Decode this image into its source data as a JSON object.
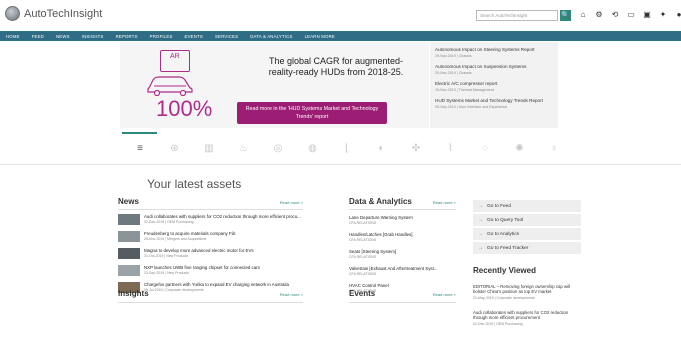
{
  "app": {
    "title": "AutoTechInsight"
  },
  "search": {
    "placeholder": "Search AutoTechInsight",
    "button": "🔍"
  },
  "top_icons": [
    "home-icon",
    "settings-gear-icon",
    "notification-icon",
    "message-icon",
    "calendar-icon",
    "gear-icon",
    "user-icon"
  ],
  "top_icon_glyphs": [
    "⌂",
    "⚙",
    "⟲",
    "▭",
    "▣",
    "✦",
    "●"
  ],
  "nav": [
    "HOME",
    "FEED",
    "NEWS",
    "INSIGHTS",
    "REPORTS",
    "PROFILES",
    "EVENTS",
    "SERVICES",
    "DATA & ANALYTICS",
    "LEARN MORE"
  ],
  "banner": {
    "badge": "AR",
    "percent": "100%",
    "headline": "The global CAGR for augmented-reality-ready HUDs from 2018-25.",
    "cta": "Read more in the 'HUD Systems Market and Technology Trends' report"
  },
  "reports": [
    {
      "title": "Autonomous Impact on Steering Systems Report",
      "meta": "29-Nov-2019 | Chassis"
    },
    {
      "title": "Autonomous Impact on Suspension Systems",
      "meta": "29-Nov-2019 | Chassis"
    },
    {
      "title": "Electric A/C compressor report",
      "meta": "19-Nov-2019 | Thermal Management"
    },
    {
      "title": "HUD Systems Market and Technology Trends Report",
      "meta": "05-Sep-2019 | User Interface and Experience"
    }
  ],
  "category_icons": [
    "list-icon",
    "wheel-icon",
    "battery-icon",
    "engine-icon",
    "steering-wheel-icon",
    "gauge-icon",
    "seat-icon",
    "thermal-icon",
    "molecule-icon",
    "wiper-icon",
    "sensor-icon",
    "fan-icon",
    "person-icon"
  ],
  "category_glyphs": [
    "≡",
    "⊛",
    "▥",
    "♨",
    "◎",
    "◍",
    "⌊",
    "◐",
    "✣",
    "⌇",
    "◌",
    "✺",
    "♀"
  ],
  "assets": {
    "title": "Your latest assets"
  },
  "news": {
    "heading": "News",
    "more": "Read more >",
    "items": [
      {
        "title": "Audi collaborates with suppliers for CO2 reduction through more efficient procu...",
        "meta": "02-Dec-2019 | OEM Purchasing"
      },
      {
        "title": "Freudenberg to acquire materials company Filc",
        "meta": "26-Nov-2019 | Mergers and Acquisitions"
      },
      {
        "title": "Magna to develop more advanced electric motor for EVs",
        "meta": "31-Oct-2019 | New Products"
      },
      {
        "title": "NXP launches UWB fine ranging chipset for connected cars",
        "meta": "23-Sep-2019 | New Products"
      },
      {
        "title": "Chargefox partners with Yurika to expand EV charging network in Australia",
        "meta": "05-Jul-2019 | Corporate developments"
      }
    ]
  },
  "data_analytics": {
    "heading": "Data & Analytics",
    "more": "Read more >",
    "items": [
      {
        "title": "Lane Departure Warning System",
        "meta": "CFA RELATIONS"
      },
      {
        "title": "Handles/Latches [Grab Handles]",
        "meta": "CFA RELATIONS"
      },
      {
        "title": "Seats [Steering System]",
        "meta": "CFA RELATIONS"
      },
      {
        "title": "Valvetrain [Exhaust And Aftertreatment Syst...",
        "meta": "CFA RELATIONS"
      },
      {
        "title": "HVAC Control Panel",
        "meta": "CFA RELATIONS"
      }
    ]
  },
  "quick_links": [
    {
      "label": "Go to Feed",
      "arrow": "→"
    },
    {
      "label": "Go to Query Tool",
      "arrow": "→"
    },
    {
      "label": "Go to Analytics",
      "arrow": "→"
    },
    {
      "label": "Go to Feed Tracker",
      "arrow": "→"
    }
  ],
  "recently_viewed": {
    "heading": "Recently Viewed",
    "items": [
      {
        "title": "EDITORIAL – Removing foreign ownership cap will bolster China's position as top EV market",
        "meta": "21-May-2019 | Corporate developments"
      },
      {
        "title": "Audi collaborates with suppliers for CO2 reduction through more efficient procurement",
        "meta": "02-Dec-2019 | OEM Purchasing"
      }
    ]
  },
  "insights": {
    "heading": "Insights",
    "more": "Read more >"
  },
  "events": {
    "heading": "Events",
    "more": "Read more >"
  },
  "colors": {
    "accent": "#2c8a7c",
    "nav": "#2f6d86",
    "brand": "#9b1e74"
  }
}
